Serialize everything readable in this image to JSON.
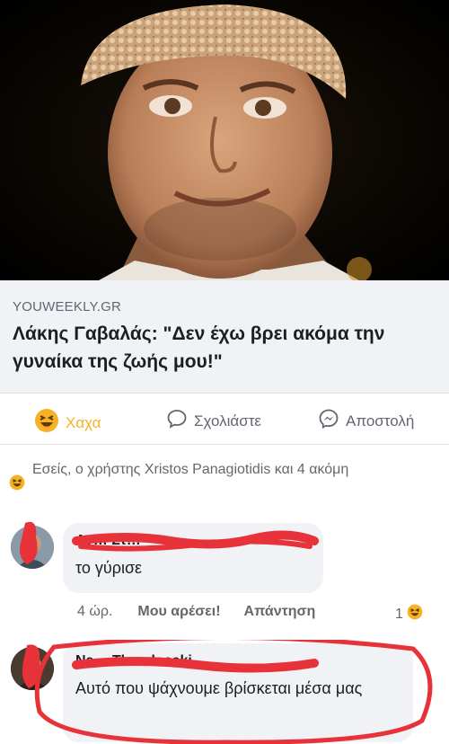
{
  "link_preview": {
    "domain": "YOUWEEKLY.GR",
    "title_line1": "Λάκης Γαβαλάς: \"Δεν έχω βρει ακόμα την",
    "title_line2": "γυναίκα της ζωής μου!\""
  },
  "actions": {
    "reaction_label": "Χαχα",
    "comment_label": "Σχολιάστε",
    "send_label": "Αποστολή"
  },
  "reactions_summary": {
    "text": "Εσείς, ο χρήστης Xristos Panagiotidis και 4 ακόμη",
    "icon": "haha-emoji"
  },
  "comments": [
    {
      "author": "Αν… Στ…",
      "text": "το γύρισε",
      "time": "4 ώρ.",
      "like_label": "Μου αρέσει!",
      "reply_label": "Απάντηση",
      "reaction_count": "1",
      "reaction_icon": "haha-emoji"
    },
    {
      "author": "Na… Theodosaki",
      "text": "Αυτό που ψάχνουμε βρίσκεται μέσα μας"
    }
  ],
  "colors": {
    "reacted": "#f7b125",
    "secondary_text": "#65676b",
    "bubble_bg": "#f0f2f5",
    "scribble_red": "#e8323a"
  }
}
